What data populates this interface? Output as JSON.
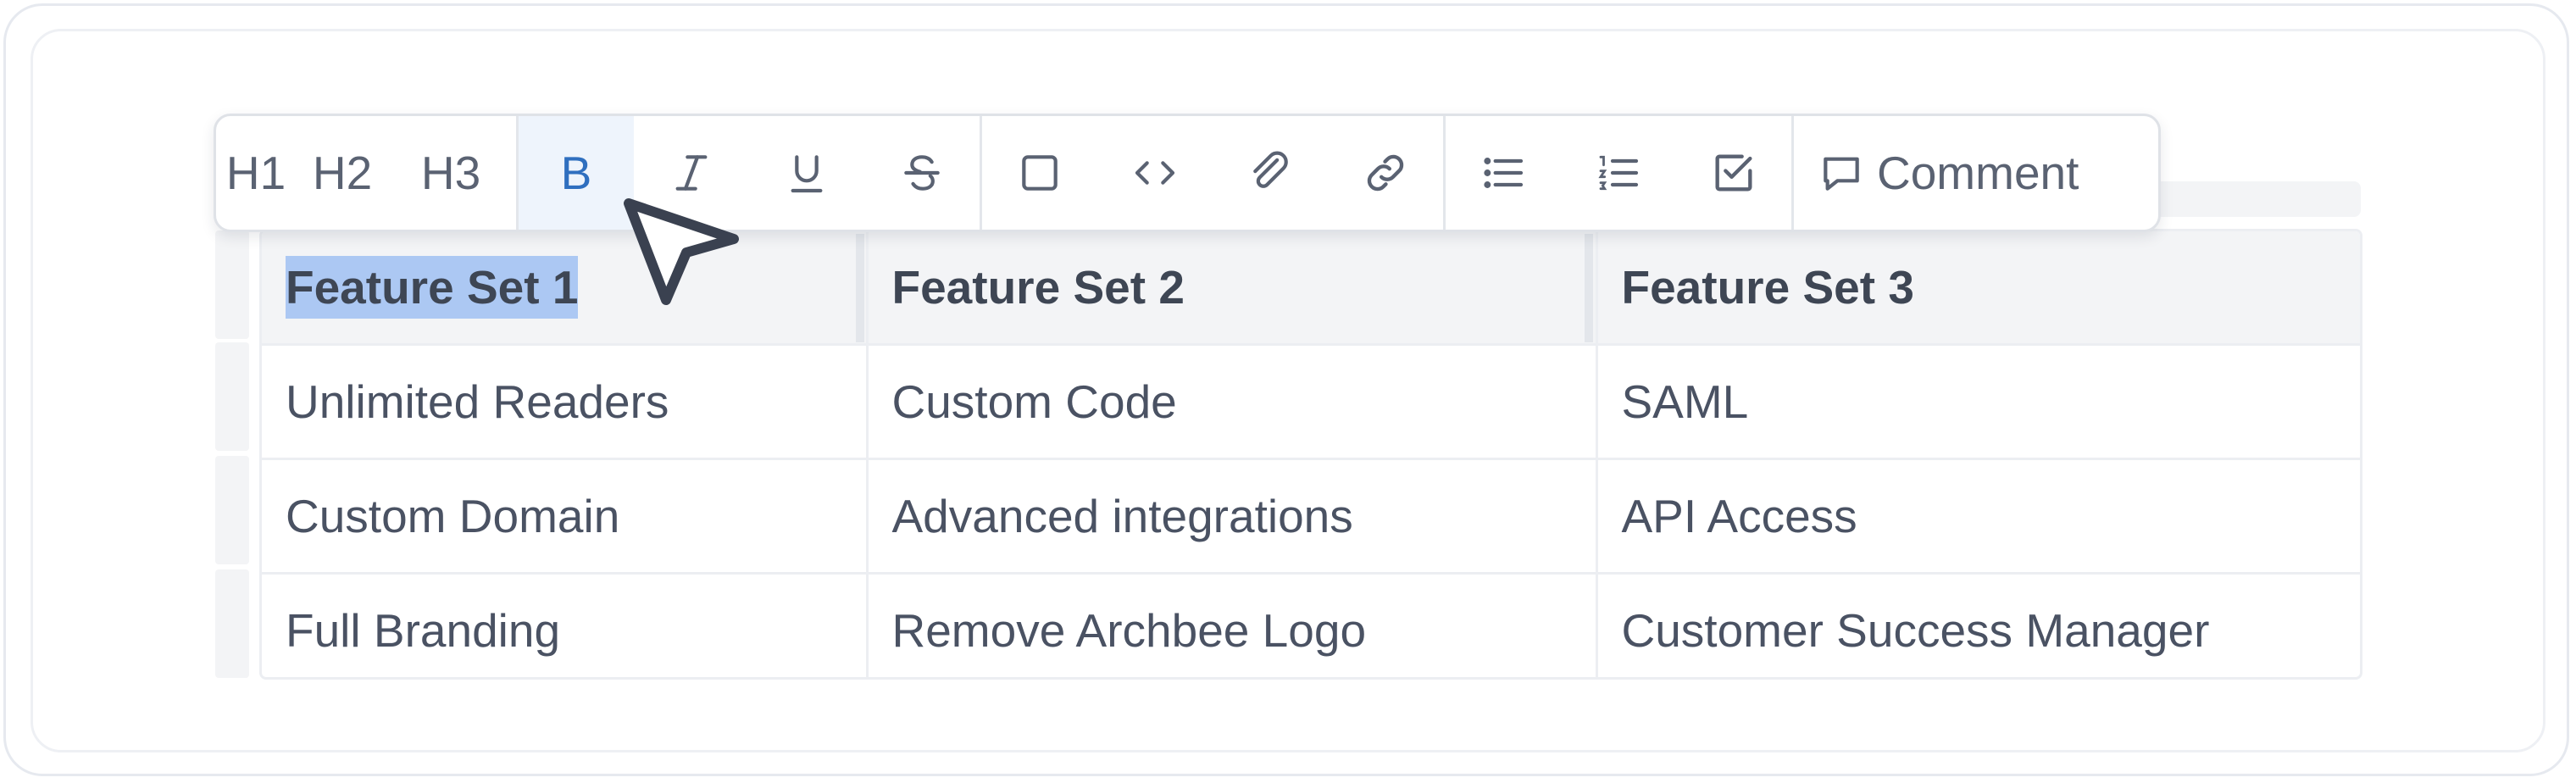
{
  "toolbar": {
    "headings": [
      {
        "label": "H1"
      },
      {
        "label": "H2"
      },
      {
        "label": "H3"
      }
    ],
    "formatting": [
      {
        "icon": "bold-icon",
        "label": "B",
        "active": true
      },
      {
        "icon": "italic-icon",
        "active": false
      },
      {
        "icon": "underline-icon",
        "active": false
      },
      {
        "icon": "strikethrough-icon",
        "active": false
      }
    ],
    "inserts": [
      {
        "icon": "box-icon"
      },
      {
        "icon": "code-icon"
      },
      {
        "icon": "attachment-icon"
      },
      {
        "icon": "link-icon"
      }
    ],
    "lists": [
      {
        "icon": "bullet-list-icon"
      },
      {
        "icon": "numbered-list-icon"
      },
      {
        "icon": "checklist-icon"
      }
    ],
    "comment": {
      "icon": "comment-icon",
      "label": "Comment"
    },
    "accent_color": "#2f6fbf"
  },
  "table": {
    "headers": [
      "Feature Set 1",
      "Feature Set 2",
      "Feature Set 3"
    ],
    "rows": [
      [
        "Unlimited Readers",
        "Custom Code",
        "SAML"
      ],
      [
        "Custom Domain",
        "Advanced integrations",
        "API Access"
      ],
      [
        "Full Branding",
        "Remove Archbee Logo",
        "Customer Success Manager"
      ]
    ],
    "selected_header_index": 0,
    "selection_color": "#acc8f3"
  }
}
